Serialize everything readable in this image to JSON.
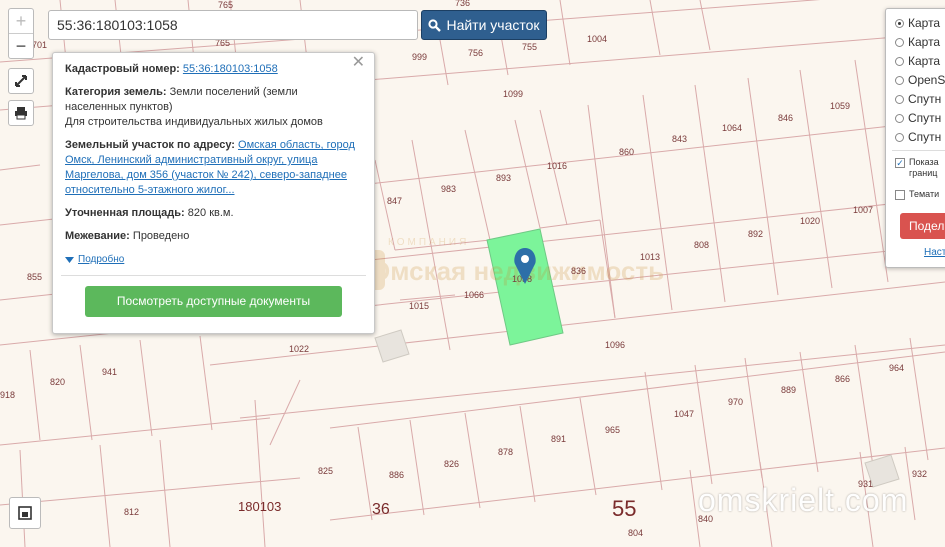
{
  "search": {
    "value": "55:36:180103:1058",
    "button_label": "Найти участок"
  },
  "zoom": {
    "in_label": "+",
    "out_label": "−"
  },
  "popup": {
    "cadastral_label": "Кадастровый номер:",
    "cadastral_value": "55:36:180103:1058",
    "category_label": "Категория земель:",
    "category_value": "Земли поселений (земли населенных пунктов)",
    "purpose": "Для строительства индивидуальных жилых домов",
    "address_label": "Земельный участок по адресу:",
    "address_value": "Омская область, город Омск, Ленинский административный округ, улица Маргелова, дом 356 (участок № 242), северо-западнее относительно 5-этажного жилог...",
    "area_label": "Уточненная площадь:",
    "area_value": "820 кв.м.",
    "survey_label": "Межевание:",
    "survey_value": "Проведено",
    "more_link": "Подробно",
    "docs_button": "Посмотреть доступные документы",
    "close_icon": "close-icon"
  },
  "layers": {
    "options": [
      {
        "label": "Карта",
        "selected": true
      },
      {
        "label": "Карта",
        "selected": false
      },
      {
        "label": "Карта",
        "selected": false
      },
      {
        "label": "OpenS",
        "selected": false
      },
      {
        "label": "Спутн",
        "selected": false
      },
      {
        "label": "Спутн",
        "selected": false
      },
      {
        "label": "Спутн",
        "selected": false
      }
    ],
    "show_boundaries_line1": "Показа",
    "show_boundaries_line2": "границ",
    "thematic": "Темати",
    "share_button": "Подел",
    "settings_link": "Наст"
  },
  "map": {
    "parcel_labels": [
      "765",
      "765",
      "736",
      "755",
      "756",
      "999",
      "1004",
      "701",
      "1099",
      "1059",
      "846",
      "1064",
      "843",
      "860",
      "1016",
      "893",
      "983",
      "847",
      "1007",
      "1020",
      "892",
      "808",
      "1013",
      "836",
      "1058",
      "1066",
      "1015",
      "855",
      "1022",
      "1096",
      "964",
      "866",
      "889",
      "970",
      "1047",
      "965",
      "891",
      "878",
      "826",
      "886",
      "825",
      "941",
      "820",
      "918",
      "812",
      "931",
      "932",
      "840",
      "804",
      "180103"
    ],
    "quarter_labels": [
      "36",
      "55"
    ],
    "watermark_line1": "КОМПАНИЯ",
    "watermark_line2": "Омская недвижимость",
    "watermark_site": "omskrielt.com",
    "colors": {
      "parcel_fill": "#7cf49a",
      "parcel_line": "#d9a7a7",
      "marker": "#2d6fa8"
    }
  }
}
